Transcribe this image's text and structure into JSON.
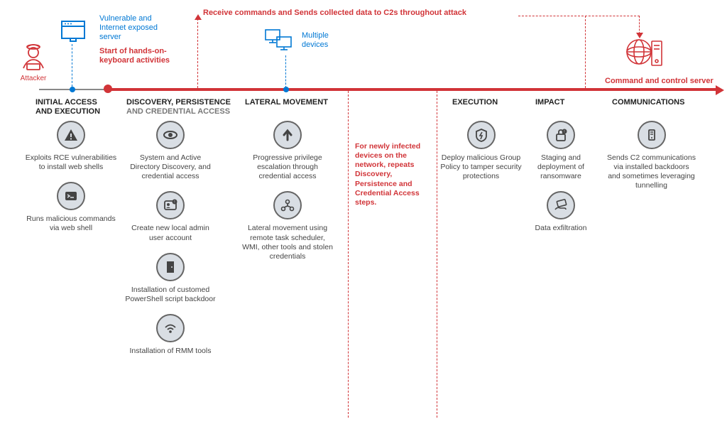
{
  "attacker": {
    "label": "Attacker"
  },
  "top": {
    "server_label": "Vulnerable and Internet exposed server",
    "start_label": "Start of hands-on-keyboard activities",
    "devices_label": "Multiple devices",
    "c2_flow_label": "Receive commands and Sends collected data to C2s throughout attack",
    "c2_server_label": "Command and control server"
  },
  "columns": [
    {
      "heading_main": "INITIAL ACCESS",
      "heading_cont": "AND EXECUTION",
      "items": [
        {
          "icon": "warning-triangle-icon",
          "text": "Exploits RCE vulnerabilities to install web shells"
        },
        {
          "icon": "terminal-icon",
          "text": "Runs malicious commands via web shell"
        }
      ]
    },
    {
      "heading_main": "DISCOVERY, PERSISTENCE",
      "heading_sub": "AND CREDENTIAL ACCESS",
      "items": [
        {
          "icon": "eye-icon",
          "text": "System and Active Directory Discovery, and credential access"
        },
        {
          "icon": "user-badge-icon",
          "text": "Create new local admin user account"
        },
        {
          "icon": "door-icon",
          "text": "Installation of customed PowerShell script backdoor"
        },
        {
          "icon": "wifi-icon",
          "text": "Installation of RMM tools"
        }
      ]
    },
    {
      "heading_main": "LATERAL MOVEMENT",
      "items": [
        {
          "icon": "arrow-up-icon",
          "text": "Progressive privilege escalation through credential access"
        },
        {
          "icon": "network-nodes-icon",
          "text": "Lateral movement using remote task scheduler, WMI, other tools and stolen credentials"
        }
      ]
    },
    {
      "heading_main": "",
      "note": "For newly infected devices on the network, repeats Discovery, Persistence and Credential Access steps.",
      "items": []
    },
    {
      "heading_main": "EXECUTION",
      "items": [
        {
          "icon": "shield-bolt-icon",
          "text": "Deploy malicious Group Policy to tamper security protections"
        }
      ]
    },
    {
      "heading_main": "IMPACT",
      "items": [
        {
          "icon": "lock-alert-icon",
          "text": "Staging and deployment of ransomware"
        },
        {
          "icon": "hand-card-icon",
          "text": "Data exfiltration"
        }
      ]
    },
    {
      "heading_main": "COMMUNICATIONS",
      "items": [
        {
          "icon": "server-comm-icon",
          "text": "Sends C2 communications via installed backdoors and sometimes leveraging tunnelling"
        }
      ]
    }
  ]
}
